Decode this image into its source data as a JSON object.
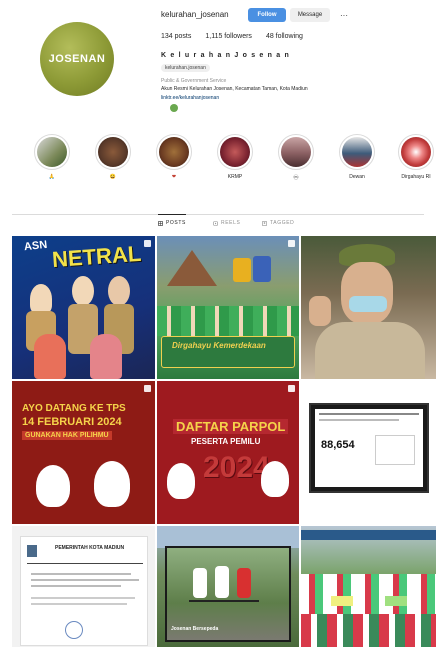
{
  "profile": {
    "username": "kelurahan_josenan",
    "avatar_text": "JOSENAN",
    "follow_label": "Follow",
    "message_label": "Message",
    "more_label": "···",
    "posts": "134 posts",
    "followers": "1,115 followers",
    "following": "48 following",
    "full_name": "K e l u r a h a n  J o s e n a n",
    "threads_handle": "kelurahan.josenan",
    "category": "Public & Government Service",
    "bio": "Akun Resmi Kelurahan Josenan, Kecamatan Taman, Kota Madiun",
    "link": "linktr.ee/kelurahanjosenan"
  },
  "highlights": [
    {
      "label": "🙏",
      "color": "#7c8a5a"
    },
    {
      "label": "😀",
      "color": "#5a3a2a"
    },
    {
      "label": "❤",
      "color": "#6b3b22"
    },
    {
      "label": "KRMP",
      "color": "#7a2330"
    },
    {
      "label": "ⓜ",
      "color": "#8a5f62"
    },
    {
      "label": "Dewan",
      "color": "#3d5b7a"
    },
    {
      "label": "Dirgahayu RI",
      "color": "#c13c3c"
    }
  ],
  "tabs": [
    {
      "label": "POSTS"
    },
    {
      "label": "REELS"
    },
    {
      "label": "TAGGED"
    }
  ],
  "posts": {
    "p1_title": "NETRAL",
    "p1_sub": "ASN",
    "p2_title": "Dirgahayu Kemerdekaan",
    "p4_line1": "AYO DATANG KE TPS",
    "p4_line2": "14 FEBRUARI 2024",
    "p4_line3": "GUNAKAN HAK PILIHMU",
    "p5_line1": "DAFTAR PARPOL",
    "p5_line2": "PESERTA PEMILU",
    "p5_line3": "2024",
    "p6_number": "88,654",
    "p7_title": "PEMERINTAH KOTA MADIUN",
    "p8_caption": "Josenan Bersepeda"
  }
}
